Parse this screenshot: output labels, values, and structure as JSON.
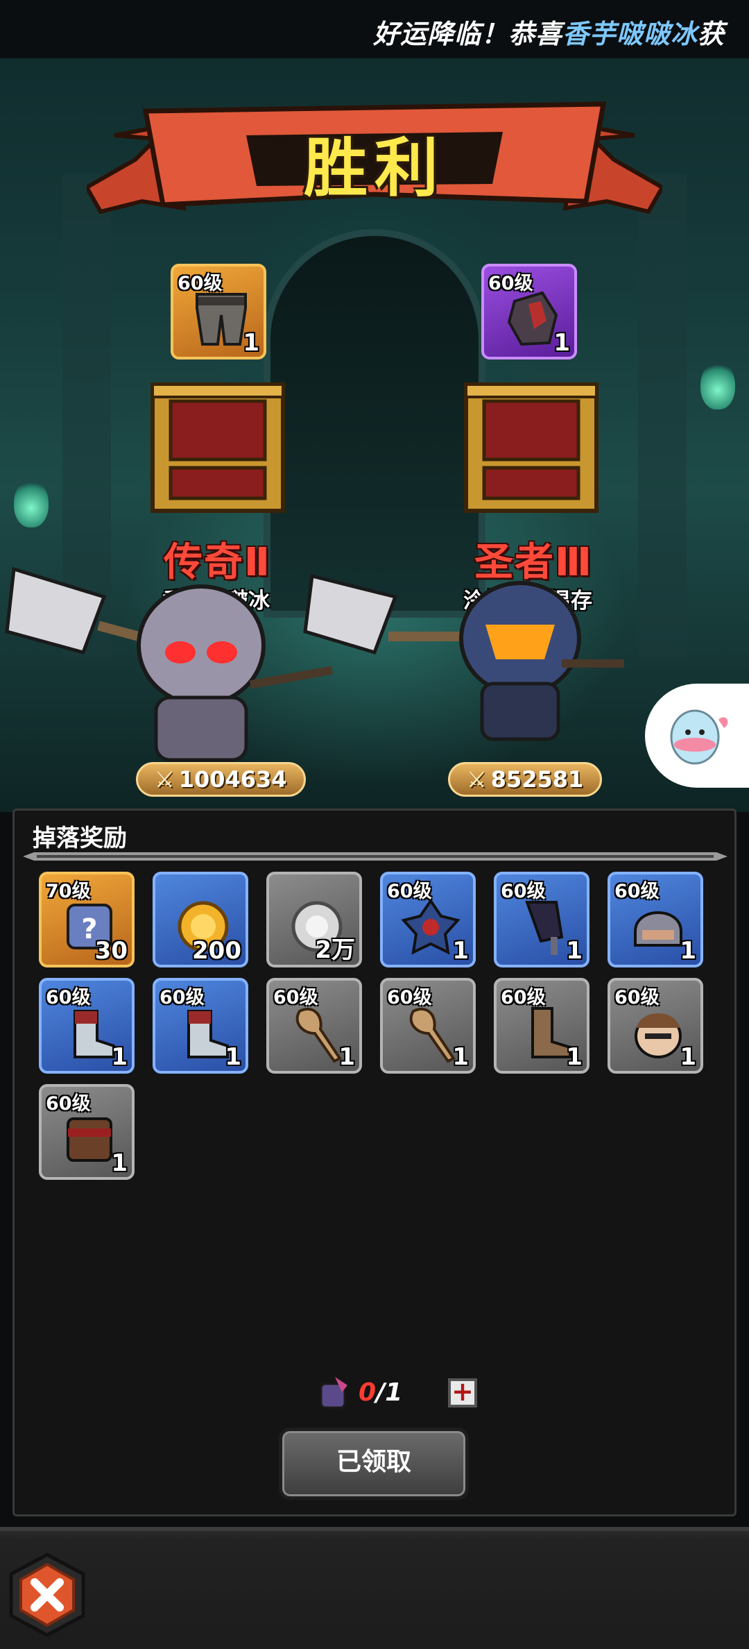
{
  "marquee": {
    "prefix": "好运降临！恭喜",
    "highlight": "香芋啵啵冰",
    "suffix": "获"
  },
  "banner": {
    "title": "胜利"
  },
  "players": [
    {
      "reward": {
        "level": "60级",
        "count": "1",
        "rarity": "gold",
        "icon": "pants-armor-icon"
      },
      "rank": "传奇Ⅱ",
      "name": "香芋啵啵冰",
      "power": "1004634"
    },
    {
      "reward": {
        "level": "60级",
        "count": "1",
        "rarity": "purple",
        "icon": "gauntlet-armor-icon"
      },
      "rank": "圣者Ⅲ",
      "name": "泠柠只愿温存",
      "power": "852581"
    }
  ],
  "loot": {
    "title": "掉落奖励",
    "items": [
      {
        "level": "70级",
        "count": "30",
        "rarity": "gold",
        "icon": "mystery-puzzle-icon"
      },
      {
        "level": "",
        "count": "200",
        "rarity": "blue",
        "icon": "gold-coin-icon"
      },
      {
        "level": "",
        "count": "2万",
        "rarity": "grey",
        "icon": "silver-coin-icon"
      },
      {
        "level": "60级",
        "count": "1",
        "rarity": "blue",
        "icon": "spiked-shoulder-icon"
      },
      {
        "level": "60级",
        "count": "1",
        "rarity": "blue",
        "icon": "dark-mace-icon"
      },
      {
        "level": "60级",
        "count": "1",
        "rarity": "blue",
        "icon": "helmet-icon"
      },
      {
        "level": "60级",
        "count": "1",
        "rarity": "blue",
        "icon": "boot-icon"
      },
      {
        "level": "60级",
        "count": "1",
        "rarity": "blue",
        "icon": "boot-icon"
      },
      {
        "level": "60级",
        "count": "1",
        "rarity": "grey",
        "icon": "wooden-club-icon"
      },
      {
        "level": "60级",
        "count": "1",
        "rarity": "grey",
        "icon": "wooden-club-icon"
      },
      {
        "level": "60级",
        "count": "1",
        "rarity": "grey",
        "icon": "leather-boot-icon"
      },
      {
        "level": "60级",
        "count": "1",
        "rarity": "grey",
        "icon": "bandit-head-icon"
      },
      {
        "level": "60级",
        "count": "1",
        "rarity": "grey",
        "icon": "bracer-icon"
      }
    ],
    "key": {
      "current": "0",
      "total": "/1",
      "icon": "key-item-icon"
    },
    "plus": "+",
    "claimed_label": "已领取"
  },
  "colors": {
    "banner": "#e2583a",
    "gold": "#f0a83a",
    "purple": "#9a4ee0",
    "blue": "#4f86dd",
    "grey": "#8c8c8c",
    "rank": "#ff4a3a",
    "highlight": "#7ec8ff"
  },
  "close": {
    "icon": "close-x-icon"
  }
}
